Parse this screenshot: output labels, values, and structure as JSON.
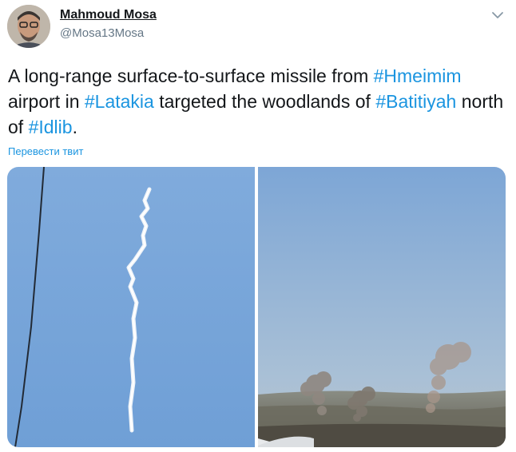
{
  "tweet": {
    "author_name": "Mahmoud Mosa",
    "author_handle": "@Mosa13Mosa",
    "text_parts": {
      "p1": "A long-range surface-to-surface missile from ",
      "h1": "#Hmeimim",
      "p2": " airport in ",
      "h2": "#Latakia",
      "p3": " targeted the woodlands of ",
      "h3": "#Batitiyah",
      "p4": " north of ",
      "h4": "#Idlib",
      "p5": "."
    },
    "translate_label": "Перевести твит"
  },
  "icons": {
    "more": "chevron-down-icon"
  },
  "colors": {
    "link": "#1b95e0",
    "sky_left": "#7ea9da",
    "sky_right": "#8bb0d9"
  }
}
